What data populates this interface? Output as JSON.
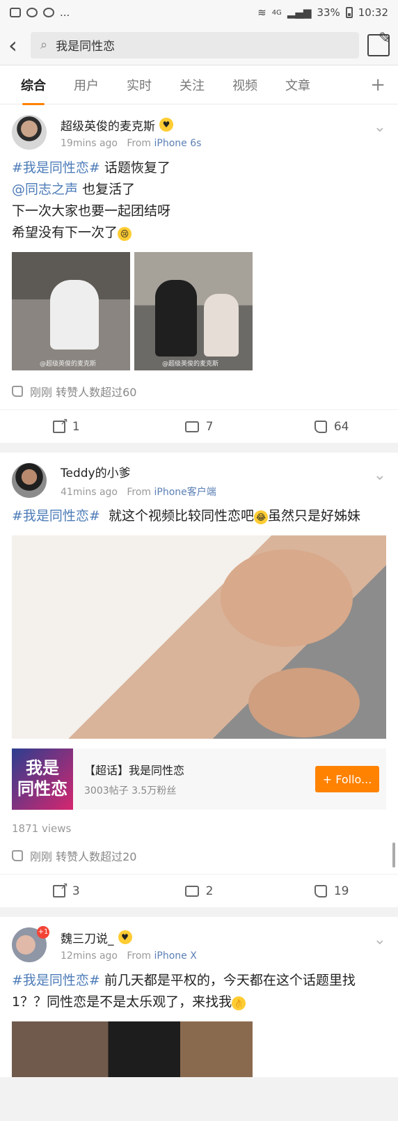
{
  "status_bar": {
    "battery": "33%",
    "time": "10:32",
    "network": "4G"
  },
  "search": {
    "query": "我是同性恋"
  },
  "tabs": [
    "综合",
    "用户",
    "实时",
    "关注",
    "视频",
    "文章"
  ],
  "posts": [
    {
      "author": "超级英俊的麦克斯",
      "time": "19mins ago",
      "from_prefix": "From",
      "source": "iPhone 6s",
      "lines": [
        "话题恢复了",
        "也复活了",
        "下一次大家也要一起团结呀",
        "希望没有下一次了"
      ],
      "hashtag": "#我是同性恋#",
      "mention": "@同志之声",
      "watermark": "@超级英俊的麦克斯",
      "repost_info": "刚刚 转赞人数超过60",
      "shares": "1",
      "comments": "7",
      "likes": "64"
    },
    {
      "author": "Teddy的小爹",
      "time": "41mins ago",
      "from_prefix": "From",
      "source": "iPhone客户端",
      "hashtag": "#我是同性恋#",
      "text_a": "就这个视频比较同性恋吧",
      "text_b": "虽然只是好姊妹",
      "topic_title": "【超话】我是同性恋",
      "topic_img_line1": "我是",
      "topic_img_line2": "同性恋",
      "topic_stats": "3003帖子 3.5万粉丝",
      "follow_label": "+ Follo...",
      "views": "1871 views",
      "repost_info": "刚刚 转赞人数超过20",
      "shares": "3",
      "comments": "2",
      "likes": "19"
    },
    {
      "author": "魏三刀说_",
      "badge": "+1",
      "time": "12mins ago",
      "from_prefix": "From",
      "source": "iPhone X",
      "hashtag": "#我是同性恋#",
      "text": "前几天都是平权的，今天都在这个话题里找1？？同性恋是不是太乐观了，来找我"
    }
  ]
}
